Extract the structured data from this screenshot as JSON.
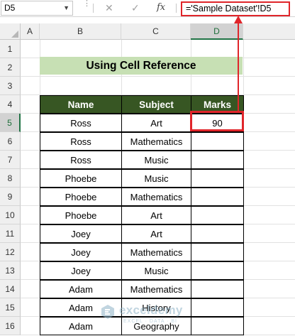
{
  "formula_bar": {
    "name_box": "D5",
    "cancel_icon": "✕",
    "enter_icon": "✓",
    "fx_label": "fx",
    "formula": "='Sample Dataset'!D5"
  },
  "columns": [
    "A",
    "B",
    "C",
    "D"
  ],
  "active_column": "D",
  "rows": [
    "1",
    "2",
    "3",
    "4",
    "5",
    "6",
    "7",
    "8",
    "9",
    "10",
    "11",
    "12",
    "13",
    "14",
    "15",
    "16"
  ],
  "active_row": "5",
  "title": "Using Cell Reference",
  "table": {
    "headers": [
      "Name",
      "Subject",
      "Marks"
    ],
    "rows": [
      [
        "Ross",
        "Art",
        "90"
      ],
      [
        "Ross",
        "Mathematics",
        ""
      ],
      [
        "Ross",
        "Music",
        ""
      ],
      [
        "Phoebe",
        "Music",
        ""
      ],
      [
        "Phoebe",
        "Mathematics",
        ""
      ],
      [
        "Phoebe",
        "Art",
        ""
      ],
      [
        "Joey",
        "Art",
        ""
      ],
      [
        "Joey",
        "Mathematics",
        ""
      ],
      [
        "Joey",
        "Music",
        ""
      ],
      [
        "Adam",
        "Mathematics",
        ""
      ],
      [
        "Adam",
        "History",
        ""
      ],
      [
        "Adam",
        "Geography",
        ""
      ]
    ]
  },
  "colors": {
    "header_fill": "#375623",
    "title_fill": "#c7e0b4",
    "highlight": "#e0252a",
    "excel_green": "#217346"
  },
  "watermark": {
    "name": "exceldemy",
    "tagline": "EXCEL · DATA · BI"
  }
}
